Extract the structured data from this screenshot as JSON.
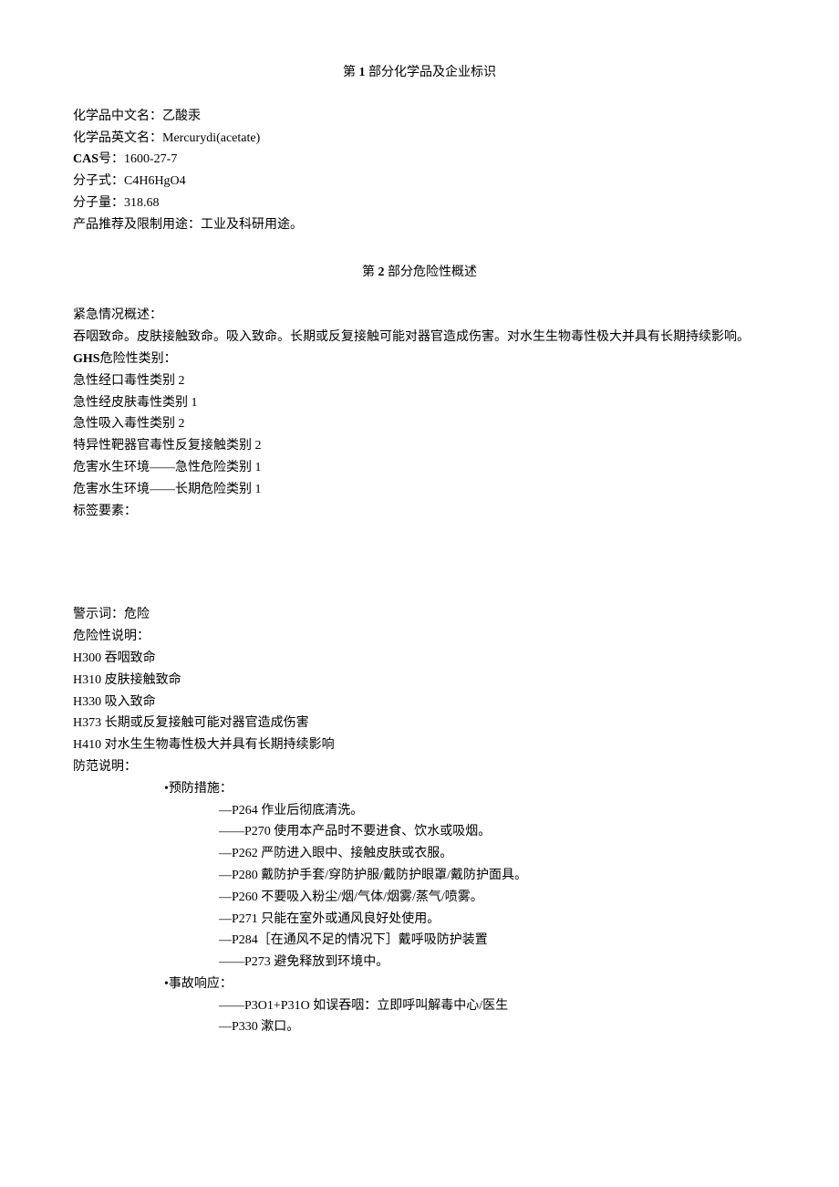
{
  "section1": {
    "title_prefix": "第",
    "title_num": "1",
    "title_suffix": "部分化学品及企业标识",
    "name_cn_label": "化学品中文名：",
    "name_cn": "乙酸汞",
    "name_en_label": "化学品英文名：",
    "name_en": "Mercurydi(acetate)",
    "cas_label": "CAS",
    "cas_label_suffix": "号：",
    "cas": "1600-27-7",
    "formula_label": "分子式：",
    "formula": "C4H6HgO4",
    "mw_label": "分子量：",
    "mw": "318.68",
    "use_label": "产品推荐及限制用途：",
    "use": "工业及科研用途。"
  },
  "section2": {
    "title_prefix": "第",
    "title_num": "2",
    "title_suffix": "部分危险性概述",
    "emergency_label": "紧急情况概述：",
    "emergency_text": "吞咽致命。皮肤接触致命。吸入致命。长期或反复接触可能对器官造成伤害。对水生生物毒性极大并具有长期持续影响。",
    "ghs_label": "GHS",
    "ghs_label_suffix": "危险性类别：",
    "ghs_categories": [
      "急性经口毒性类别 2",
      "急性经皮肤毒性类别 1",
      "急性吸入毒性类别 2",
      "特异性靶器官毒性反复接触类别 2",
      "危害水生环境——急性危险类别 1",
      "危害水生环境——长期危险类别 1"
    ],
    "label_elements": "标签要素：",
    "signal_label": "警示词：",
    "signal": "危险",
    "hazard_stmt_label": "危险性说明：",
    "hazard_statements": [
      "H300 吞咽致命",
      "H310 皮肤接触致命",
      "H330 吸入致命",
      "H373 长期或反复接触可能对器官造成伤害",
      "H410 对水生生物毒性极大并具有长期持续影响"
    ],
    "precaution_label": "防范说明：",
    "prevention_header": "•预防措施：",
    "prevention_items": [
      "—P264 作业后彻底清洗。",
      "——P270 使用本产品时不要进食、饮水或吸烟。",
      "—P262 严防进入眼中、接触皮肤或衣服。",
      "—P280 戴防护手套/穿防护服/戴防护眼罩/戴防护面具。",
      "—P260 不要吸入粉尘/烟/气体/烟雾/蒸气/喷雾。",
      "—P271 只能在室外或通风良好处使用。",
      "—P284［在通风不足的情况下］戴呼吸防护装置",
      "——P273 避免释放到环境中。"
    ],
    "response_header": "•事故响应：",
    "response_items": [
      "——P3O1+P31O 如误吞咽：立即呼叫解毒中心/医生",
      "—P330 漱口。"
    ]
  }
}
